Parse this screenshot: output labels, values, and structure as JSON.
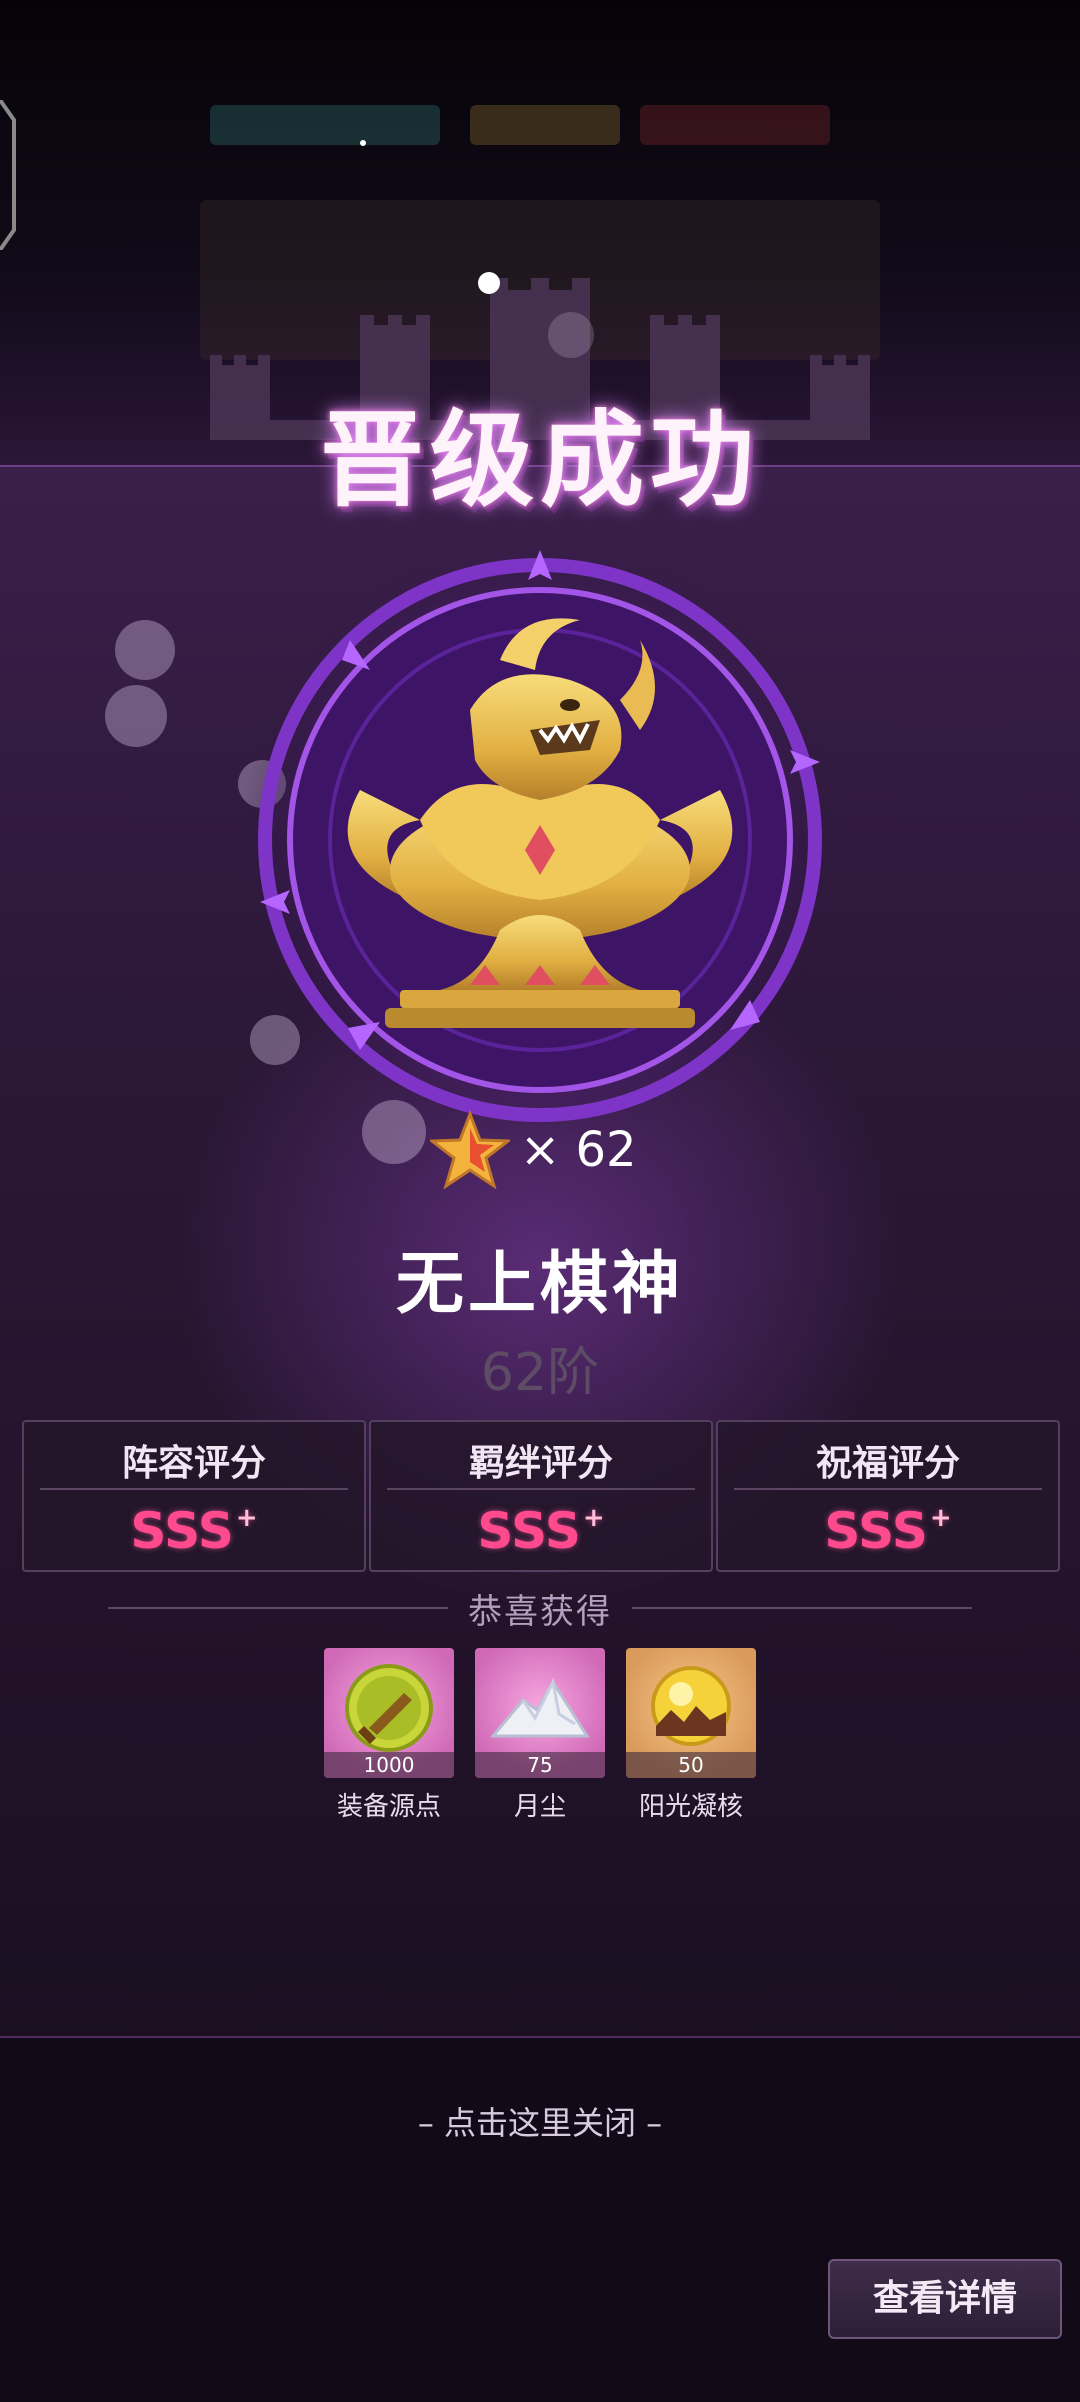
{
  "popup": {
    "title": "晋级成功",
    "star_count": "× 62",
    "rank_name": "无上棋神",
    "rank_level": "62阶"
  },
  "scores": [
    {
      "label": "阵容评分",
      "value": "SSS",
      "plus": "+"
    },
    {
      "label": "羁绊评分",
      "value": "SSS",
      "plus": "+"
    },
    {
      "label": "祝福评分",
      "value": "SSS",
      "plus": "+"
    }
  ],
  "rewards": {
    "header": "恭喜获得",
    "items": [
      {
        "name": "装备源点",
        "count": "1000",
        "icon": "equipment-source-icon"
      },
      {
        "name": "月尘",
        "count": "75",
        "icon": "moon-dust-icon"
      },
      {
        "name": "阳光凝核",
        "count": "50",
        "icon": "sunlight-core-icon"
      }
    ]
  },
  "footer": {
    "close_hint": "– 点击这里关闭 –",
    "details_button": "查看详情"
  },
  "colors": {
    "accent_pink": "#ff4a8e",
    "panel_purple": "#3a1f4a",
    "gold": "#e8b54a"
  }
}
